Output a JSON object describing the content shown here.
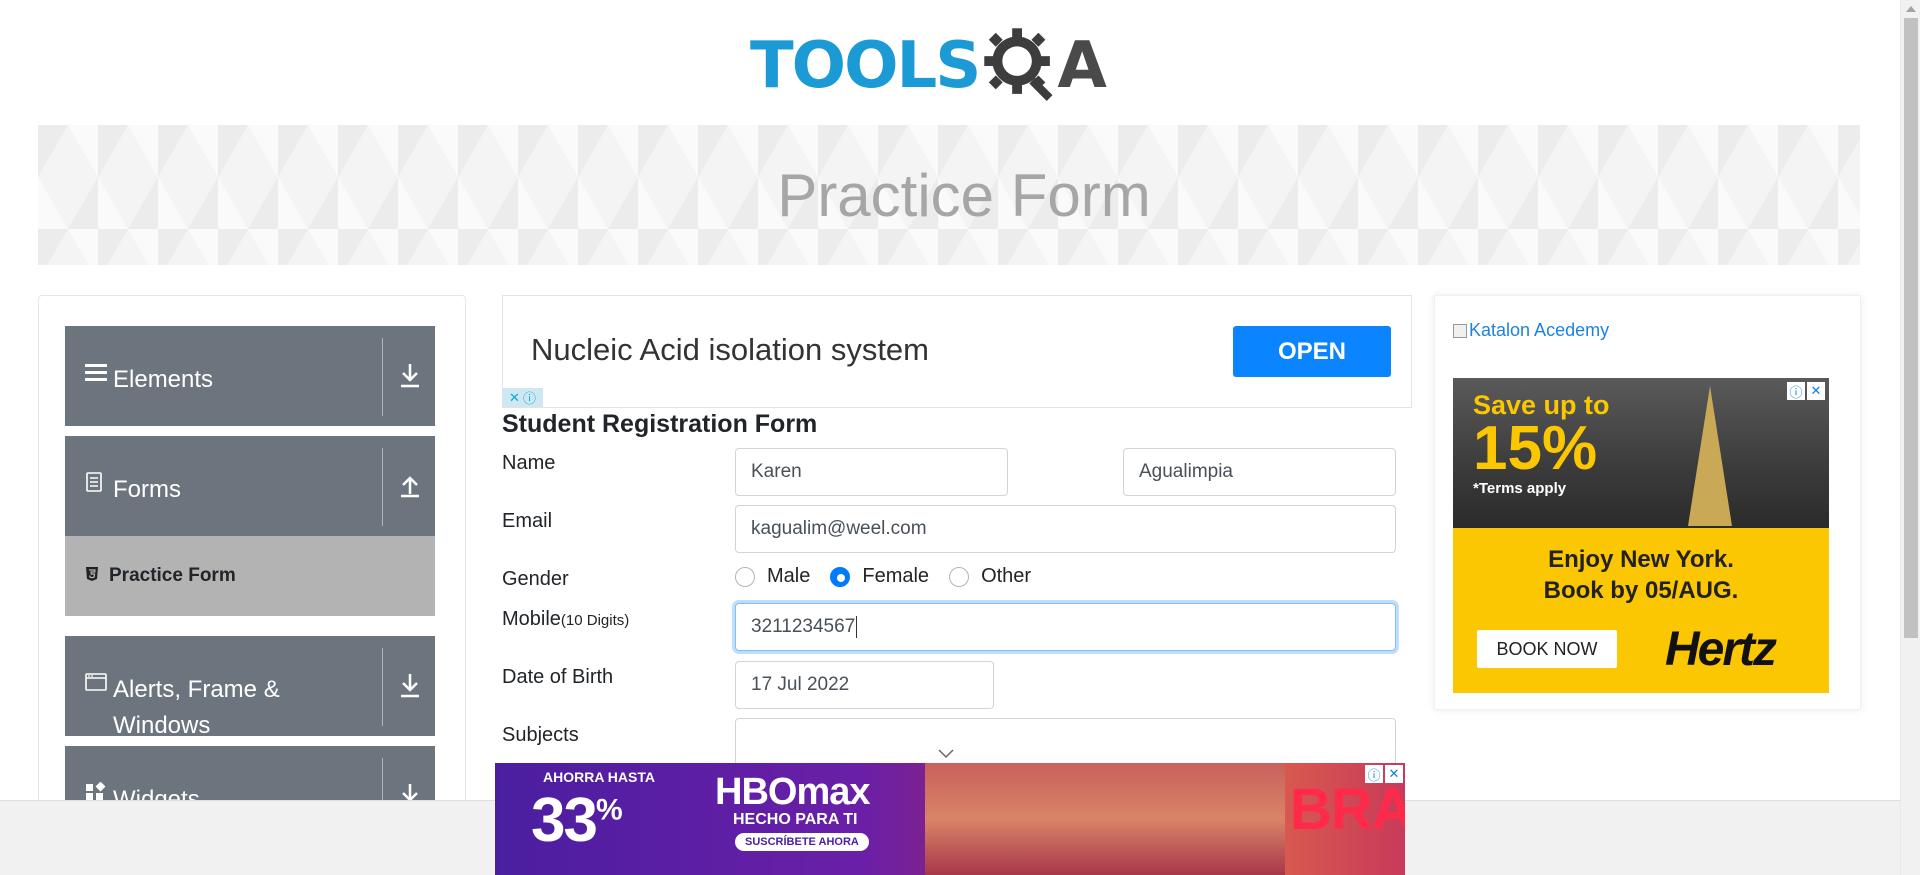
{
  "header": {
    "logo_text": "TOOLS",
    "logo_text_end": "A",
    "logo_alt": "ToolsQA"
  },
  "banner": {
    "title": "Practice Form"
  },
  "sidebar": {
    "groups": [
      {
        "label": "Elements",
        "icon": "menu-icon",
        "arrow": "download-icon"
      },
      {
        "label": "Forms",
        "icon": "document-icon",
        "arrow": "upload-icon"
      },
      {
        "label": "Alerts, Frame & Windows",
        "icon": "window-icon",
        "arrow": "download-icon"
      },
      {
        "label": "Widgets",
        "icon": "widgets-icon",
        "arrow": "download-icon"
      }
    ],
    "active_item": {
      "label": "Practice Form",
      "icon": "html5-icon"
    }
  },
  "ad_top": {
    "text": "Nucleic Acid isolation system",
    "button": "OPEN"
  },
  "form": {
    "title": "Student Registration Form",
    "name_label": "Name",
    "first_name": "Karen",
    "last_name": "Agualimpia",
    "email_label": "Email",
    "email": "kagualim@weel.com",
    "gender_label": "Gender",
    "gender_options": [
      "Male",
      "Female",
      "Other"
    ],
    "gender_selected": "Female",
    "mobile_label": "Mobile",
    "mobile_hint": "(10 Digits)",
    "mobile": "3211234567",
    "dob_label": "Date of Birth",
    "dob": "17 Jul 2022",
    "subjects_label": "Subjects"
  },
  "right_ad": {
    "katalon_alt": "Katalon Acedemy",
    "save": "Save up to",
    "percent": "15%",
    "terms": "*Terms apply",
    "enjoy_line1": "Enjoy New York.",
    "enjoy_line2": "Book by 05/AUG.",
    "book_button": "BOOK NOW",
    "brand": "Hertz"
  },
  "bottom_ad": {
    "ahorra": "AHORRA HASTA",
    "percent": "33",
    "percent_sign": "%",
    "logo": "HBOmax",
    "hecho": "HECHO PARA TI",
    "subscribe": "SUSCRÍBETE AHORA",
    "show": "BRAVAS"
  },
  "colors": {
    "accent": "#007bff",
    "sidebar_group": "#6c757d",
    "sidebar_active": "#b3b3b3",
    "logo_blue": "#1c9ad6",
    "hertz_yellow": "#fbc602"
  }
}
